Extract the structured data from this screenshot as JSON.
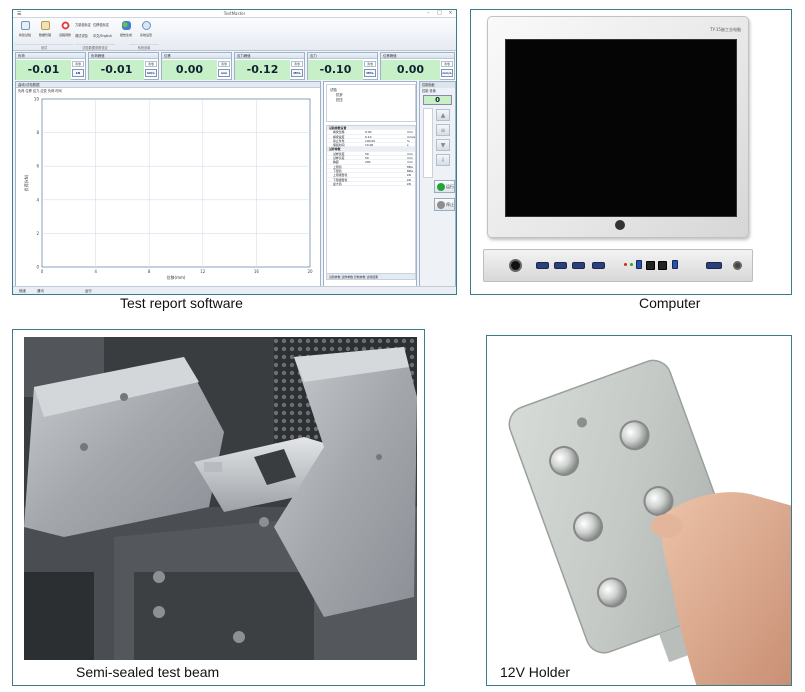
{
  "captions": {
    "software": "Test report software",
    "computer": "Computer",
    "beam": "Semi-sealed test beam",
    "holder": "12V Holder"
  },
  "software": {
    "window_title": "TestMaster",
    "ribbon": {
      "buttons": [
        "新建试验",
        "数据管理",
        "远程调整",
        "报告生成",
        "系统设置"
      ],
      "small_items": [
        "力量值标定",
        "位移值标定",
        "调试试验",
        "中文/English"
      ],
      "groups": [
        "测试",
        "试验数据参数设定",
        "系统设置"
      ]
    },
    "meters": [
      {
        "label": "负荷",
        "value": "-0.01",
        "unit": "kN",
        "zero": "清零"
      },
      {
        "label": "负荷峰值",
        "value": "-0.01",
        "unit": "kN/s",
        "zero": "清零"
      },
      {
        "label": "位移",
        "value": "0.00",
        "unit": "mm",
        "zero": "清零"
      },
      {
        "label": "应力峰值",
        "value": "-0.12",
        "unit": "MPa",
        "zero": "清零"
      },
      {
        "label": "应力",
        "value": "-0.10",
        "unit": "MPa",
        "zero": "清零"
      },
      {
        "label": "位移峰值",
        "value": "0.00",
        "unit": "mm/s",
        "zero": "清零"
      }
    ],
    "chart_panel_title": "曲线/试验数据",
    "chart_tabs": "负荷-位移  应力-应变  负荷-时间",
    "tree": [
      "试验",
      "抗折",
      "抗压"
    ],
    "props": [
      {
        "name": "试验参数设置",
        "value": "",
        "unit": "",
        "section": true
      },
      {
        "name": "横梁位移",
        "value": "0.00",
        "unit": "mm",
        "section": false
      },
      {
        "name": "横梁速度",
        "value": "0.10",
        "unit": "mm/s",
        "section": false
      },
      {
        "name": "停止条件",
        "value": "100.00",
        "unit": "%",
        "section": false
      },
      {
        "name": "保载时间",
        "value": "10.00",
        "unit": "s",
        "section": false
      },
      {
        "name": "试样参数",
        "value": "",
        "unit": "",
        "section": true
      },
      {
        "name": "试样宽度",
        "value": "50",
        "unit": "mm",
        "section": false
      },
      {
        "name": "试样高度",
        "value": "50",
        "unit": "mm",
        "section": false
      },
      {
        "name": "跨距",
        "value": "200",
        "unit": "mm",
        "section": false
      },
      {
        "name": "上限值",
        "value": "",
        "unit": "MPa",
        "section": false
      },
      {
        "name": "下限值",
        "value": "",
        "unit": "MPa",
        "section": false
      },
      {
        "name": "上限报警值",
        "value": "",
        "unit": "kN",
        "section": false
      },
      {
        "name": "下限报警值",
        "value": "",
        "unit": "kN",
        "section": false
      },
      {
        "name": "最大值",
        "value": "",
        "unit": "kN",
        "section": false
      }
    ],
    "props_tabs": "试验参数  试样参数  控制参数  试验结果",
    "side_head": "控制面板",
    "side_tabs": "控制  设置",
    "side_zero": "0",
    "run_label": "运行",
    "stop_label": "停止",
    "status": [
      "就绪",
      "通讯",
      "运行"
    ]
  },
  "chart_data": {
    "type": "line",
    "title": "",
    "xlabel": "位移(mm)",
    "ylabel": "负荷(kN)",
    "xlim": [
      0,
      20
    ],
    "ylim": [
      0,
      10
    ],
    "x_ticks": [
      "0",
      "4",
      "8",
      "12",
      "16",
      "20"
    ],
    "y_ticks": [
      "0",
      "2",
      "4",
      "6",
      "8",
      "10"
    ],
    "grid": true,
    "series": []
  },
  "computer": {
    "brand": "TY-15嵌工业电脑"
  },
  "colors": {
    "panel_border": "#3a7c8c",
    "meter_green": "#c8f0c8",
    "run_green": "#23a33a",
    "stop_gray": "#8d8d8d"
  }
}
